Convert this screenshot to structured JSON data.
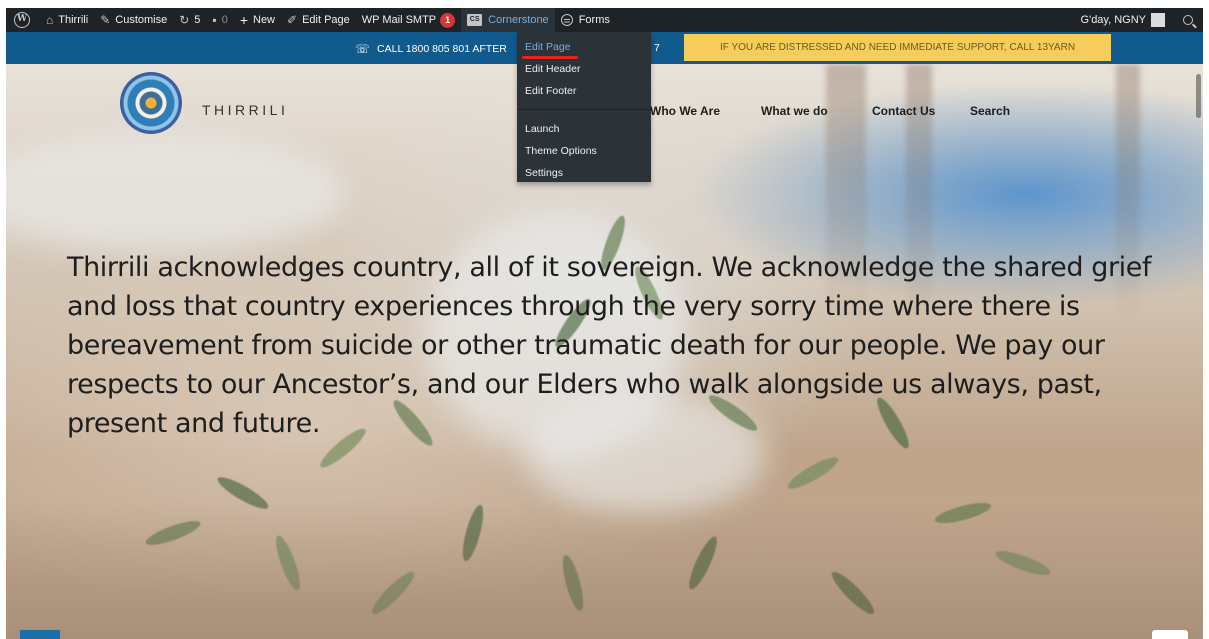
{
  "adminbar": {
    "site": "Thirrili",
    "customise": "Customise",
    "updates": "5",
    "comments": "0",
    "new": "New",
    "edit_page": "Edit Page",
    "wp_mail": "WP Mail SMTP",
    "wp_mail_badge": "1",
    "cornerstone": "Cornerstone",
    "cornerstone_logo": "CS",
    "forms": "Forms",
    "greeting": "G'day, NGNY"
  },
  "dropdown": {
    "items": [
      "Edit Page",
      "Edit Header",
      "Edit Footer"
    ],
    "items2": [
      "Launch",
      "Theme Options",
      "Settings"
    ]
  },
  "topbar": {
    "phone": "CALL 1800 805 801 AFTER",
    "phone_suffix": "7",
    "alert": "IF YOU ARE DISTRESSED AND NEED IMMEDIATE SUPPORT, CALL 13YARN"
  },
  "site": {
    "logo_text": "THIRRILI",
    "nav": [
      "Who We Are",
      "What we do",
      "Contact Us",
      "Search"
    ]
  },
  "hero": {
    "acknowledgement": "Thirrili acknowledges country, all of it sovereign. We acknowledge the shared grief and loss that country experiences through the very sorry time where there is bereavement from suicide or other traumatic death for our people. We pay our respects to our Ancestor’s, and our Elders who walk alongside us always, past, present and future."
  },
  "colors": {
    "adminbar": "#1d2327",
    "topbar": "#105a8e",
    "alert": "#f6cc5b",
    "highlight": "#e0261e",
    "link": "#72aee6"
  },
  "icons": [
    "wordpress-icon",
    "home-icon",
    "brush-icon",
    "refresh-icon",
    "comment-icon",
    "plus-icon",
    "pencil-icon",
    "phone-icon",
    "forms-icon",
    "search-icon"
  ]
}
